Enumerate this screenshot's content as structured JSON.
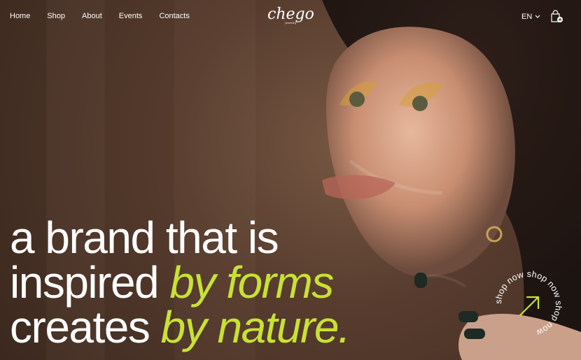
{
  "brand": {
    "name": "chego",
    "subtitle": "jewelry"
  },
  "nav": {
    "items": [
      {
        "label": "Home"
      },
      {
        "label": "Shop"
      },
      {
        "label": "About"
      },
      {
        "label": "Events"
      },
      {
        "label": "Contacts"
      }
    ]
  },
  "header": {
    "language": "EN"
  },
  "hero": {
    "line1": "a brand that is",
    "line2_prefix": "inspired ",
    "line2_accent": "by forms",
    "line3_prefix": "creates ",
    "line3_accent": "by nature.",
    "accent_color": "#c8e234",
    "badge_text": "shop now shop now shop now "
  },
  "icons": {
    "chevron": "chevron-down-icon",
    "bag": "shopping-bag-icon",
    "arrow": "arrow-up-right-icon"
  }
}
